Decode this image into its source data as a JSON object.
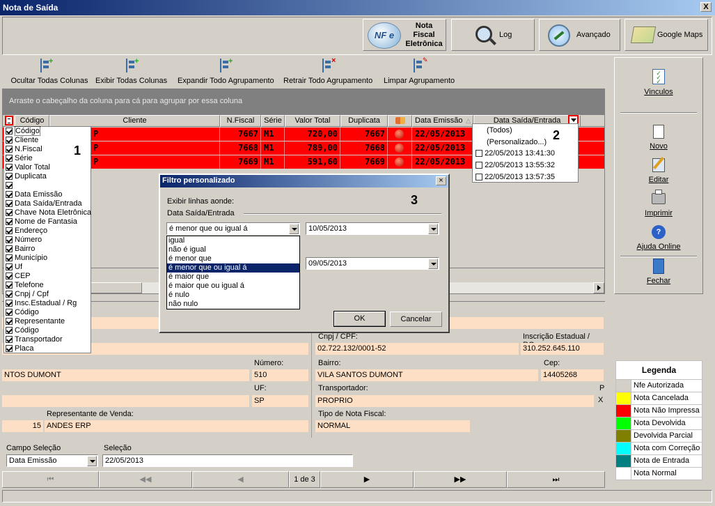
{
  "window": {
    "title": "Nota de Saída",
    "close": "X"
  },
  "top_buttons": {
    "nfe_l1": "Nota",
    "nfe_l2": "Fiscal",
    "nfe_l3": "Eletrônica",
    "nfe_logo": "NF e",
    "log": "Log",
    "avancado": "Avançado",
    "maps": "Google Maps"
  },
  "grid_toolbar": {
    "hide_cols": "Ocultar Todas Colunas",
    "show_cols": "Exibir Todas  Colunas",
    "expand": "Expandir Todo Agrupamento",
    "collapse": "Retrair Todo Agrupamento",
    "clear": "Limpar Agrupamento"
  },
  "group_hint": "Arraste o cabeçalho da coluna para cá para agrupar por essa coluna",
  "columns": [
    "Código",
    "Cliente",
    "N.Fiscal",
    "Série",
    "Valor Total",
    "Duplicata",
    "",
    "Data Emissão",
    "Data Saída/Entrada"
  ],
  "rows": [
    {
      "codigo": "P",
      "nfiscal": "7667",
      "serie": "M1",
      "valor": "720,00",
      "duplicata": "7667",
      "emissao": "22/05/2013"
    },
    {
      "codigo": "P",
      "nfiscal": "7668",
      "serie": "M1",
      "valor": "789,00",
      "duplicata": "7668",
      "emissao": "22/05/2013"
    },
    {
      "codigo": "P",
      "nfiscal": "7669",
      "serie": "M1",
      "valor": "591,60",
      "duplicata": "7669",
      "emissao": "22/05/2013"
    }
  ],
  "column_chooser": [
    {
      "label": "Código",
      "checked": true
    },
    {
      "label": "Cliente",
      "checked": true
    },
    {
      "label": "N.Fiscal",
      "checked": true
    },
    {
      "label": "Série",
      "checked": true
    },
    {
      "label": "Valor Total",
      "checked": true
    },
    {
      "label": "Duplicata",
      "checked": true
    },
    {
      "label": "",
      "checked": true
    },
    {
      "label": "Data Emissão",
      "checked": true
    },
    {
      "label": "Data Saída/Entrada",
      "checked": true
    },
    {
      "label": "Chave Nota Eletrônica",
      "checked": true
    },
    {
      "label": "Nome de Fantasia",
      "checked": true
    },
    {
      "label": "Endereço",
      "checked": true
    },
    {
      "label": "Número",
      "checked": true
    },
    {
      "label": "Bairro",
      "checked": true
    },
    {
      "label": "Município",
      "checked": true
    },
    {
      "label": "Uf",
      "checked": true
    },
    {
      "label": "CEP",
      "checked": true
    },
    {
      "label": "Telefone",
      "checked": true
    },
    {
      "label": "Cnpj / Cpf",
      "checked": true
    },
    {
      "label": "Insc.Estadual / Rg",
      "checked": true
    },
    {
      "label": "Código",
      "checked": true
    },
    {
      "label": "Representante",
      "checked": true
    },
    {
      "label": "Código",
      "checked": true
    },
    {
      "label": "Transportador",
      "checked": true
    },
    {
      "label": "Placa",
      "checked": true
    }
  ],
  "callouts": {
    "one": "1",
    "two": "2",
    "three": "3"
  },
  "filter_dropdown": {
    "items": [
      "(Todos)",
      "(Personalizado...)"
    ],
    "dates": [
      "22/05/2013 13:41:30",
      "22/05/2013 13:55:32",
      "22/05/2013 13:57:35"
    ]
  },
  "dialog": {
    "title": "Filtro personalizado",
    "show_rows": "Exibir linhas aonde:",
    "field": "Data Saída/Entrada",
    "op1": "é menor que ou igual á",
    "value1": "10/05/2013",
    "value2": "09/05/2013",
    "ok": "OK",
    "cancel": "Cancelar",
    "options": [
      "igual",
      "não é igual",
      "é menor que",
      "é menor que ou igual á",
      "é maior que",
      "é maior que ou igual á",
      "é nulo",
      "não nulo"
    ],
    "selected_index": 3
  },
  "detail": {
    "cnpj_label": "Cnpj / CPF:",
    "cnpj": "02.722.132/0001-52",
    "ie_label": "Inscrição Estadual / RG:",
    "ie": "310.252.645.110",
    "numero_label": "Número:",
    "numero": "510",
    "endereco": "NTOS DUMONT",
    "bairro_label": "Bairro:",
    "bairro": "VILA SANTOS DUMONT",
    "cep_label": "Cep:",
    "cep": "14405268",
    "uf_label": "UF:",
    "uf": "SP",
    "transp_label": "Transportador:",
    "transp": "PROPRIO",
    "p_label": "P",
    "x_val": "X",
    "rep_label": "Representante de Venda:",
    "rep_code": "15",
    "rep_name": "ANDES ERP",
    "tipo_label": "Tipo de Nota Fiscal:",
    "tipo": "NORMAL"
  },
  "bottom": {
    "campo_label": "Campo Seleção",
    "campo_value": "Data Emissão",
    "selecao_label": "Seleção",
    "selecao_value": "22/05/2013",
    "page": "1 de 3"
  },
  "right_panel": {
    "vinculos": "Vinculos",
    "novo": "Novo",
    "editar": "Editar",
    "imprimir": "Imprimir",
    "ajuda": "Ajuda Online",
    "fechar": "Fechar"
  },
  "legend": {
    "title": "Legenda",
    "items": [
      {
        "label": "Nfe Autorizada",
        "color": "#d4d0c8"
      },
      {
        "label": "Nota Cancelada",
        "color": "#ffff00"
      },
      {
        "label": "Nota Não  Impressa",
        "color": "#ff0000"
      },
      {
        "label": "Nota Devolvida",
        "color": "#00ff00"
      },
      {
        "label": "Devolvida Parcial",
        "color": "#808000"
      },
      {
        "label": "Nota com Correção",
        "color": "#00ffff"
      },
      {
        "label": "Nota de Entrada",
        "color": "#008080"
      },
      {
        "label": "Nota Normal",
        "color": "#ffffff"
      }
    ]
  },
  "colors": {
    "title_bar": "#0a246a",
    "row_red": "#ff0000",
    "field_bg": "#fddfc5",
    "grid_header_dark": "#808080"
  }
}
